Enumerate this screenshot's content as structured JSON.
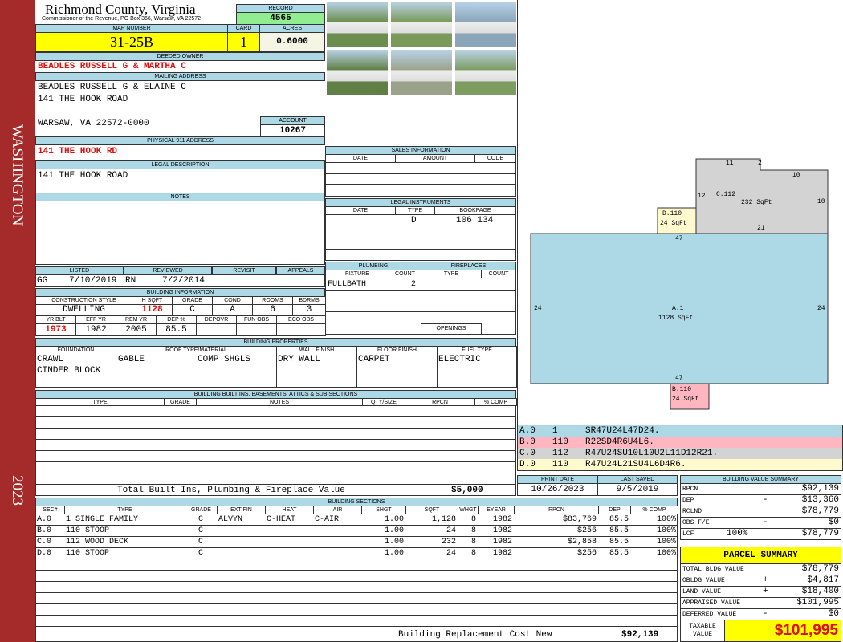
{
  "sidebar": {
    "district": "WASHINGTON",
    "year": "2023"
  },
  "header": {
    "county": "Richmond County, Virginia",
    "subtitle": "Commissioner of the Revenue, PO Box 366, Warsaw, VA 22572",
    "record_label": "RECORD",
    "record": "4565"
  },
  "map": {
    "map_label": "MAP NUMBER",
    "map_number": "31-25B",
    "card_label": "CARD",
    "card": "1",
    "acres_label": "ACRES",
    "acres": "0.6000"
  },
  "owner": {
    "label": "DEEDED OWNER",
    "name": "BEADLES RUSSELL G & MARTHA C"
  },
  "mailing": {
    "label": "MAILING ADDRESS",
    "line1": "BEADLES RUSSELL G & ELAINE C",
    "line2": "141 THE HOOK ROAD",
    "line3": "WARSAW, VA 22572-0000",
    "account_label": "ACCOUNT",
    "account": "10267"
  },
  "physical": {
    "label": "PHYSICAL 911 ADDRESS",
    "address": "141 THE HOOK RD"
  },
  "legal": {
    "label": "LEGAL DESCRIPTION",
    "text": "141 THE HOOK ROAD"
  },
  "notes": {
    "label": "NOTES"
  },
  "review": {
    "listed_label": "LISTED",
    "listed_by": "GG",
    "listed_date": "7/10/2019",
    "reviewed_label": "REVIEWED",
    "reviewed_by": "RN",
    "reviewed_date": "7/2/2014",
    "revisit_label": "REVISIT",
    "appeals_label": "APPEALS"
  },
  "building_info": {
    "label": "BUILDING INFORMATION",
    "h1": [
      "CONSTRUCTION STYLE",
      "H SQFT",
      "GRADE",
      "COND",
      "ROOMS",
      "BDRMS"
    ],
    "v1": [
      "DWELLING",
      "1128",
      "C",
      "A",
      "6",
      "3"
    ],
    "h2": [
      "YR BLT",
      "EFF YR",
      "REM YR",
      "DEP %",
      "DEPOVR",
      "FUN OBS",
      "ECO OBS"
    ],
    "v2": [
      "1973",
      "1982",
      "2005",
      "85.5",
      "",
      "",
      ""
    ]
  },
  "properties": {
    "label": "BUILDING PROPERTIES",
    "headers": [
      "FOUNDATION",
      "ROOF TYPE/MATERIAL",
      "WALL FINISH",
      "FLOOR FINISH",
      "FUEL TYPE"
    ],
    "foundation": [
      "CRAWL",
      "CINDER BLOCK"
    ],
    "roof_type": "GABLE",
    "roof_material": "COMP SHGLS",
    "wall": "DRY WALL",
    "floor": "CARPET",
    "fuel": "ELECTRIC"
  },
  "builtins": {
    "label": "BUILDING BUILT INS, BASEMENTS, ATTICS & SUB SECTIONS",
    "headers": [
      "TYPE",
      "GRADE",
      "NOTES",
      "QTY/SIZE",
      "RPCN",
      "% COMP"
    ],
    "total_label": "Total Built Ins, Plumbing & Fireplace Value",
    "total": "$5,000"
  },
  "sales": {
    "label": "SALES INFORMATION",
    "headers": [
      "DATE",
      "AMOUNT",
      "CODE"
    ]
  },
  "instruments": {
    "label": "LEGAL INSTRUMENTS",
    "headers": [
      "DATE",
      "TYPE",
      "BOOKPAGE"
    ],
    "rows": [
      {
        "date": "",
        "type": "D",
        "bookpage": "106 134"
      }
    ]
  },
  "plumbing": {
    "label": "PLUMBING",
    "headers": [
      "FIXTURE",
      "COUNT"
    ],
    "rows": [
      {
        "fixture": "FULLBATH",
        "count": "2"
      }
    ]
  },
  "fireplaces": {
    "label": "FIREPLACES",
    "headers": [
      "TYPE",
      "COUNT"
    ],
    "openings_label": "OPENINGS"
  },
  "sections": {
    "label": "BUILDING SECTIONS",
    "headers": [
      "SEC#",
      "TYPE",
      "GRADE",
      "EXT FIN",
      "HEAT",
      "AIR",
      "SHGT",
      "SQFT",
      "WHGT",
      "EYEAR",
      "RPCN",
      "DEP",
      "% COMP"
    ],
    "rows": [
      [
        "A.0",
        "1 SINGLE FAMILY",
        "C",
        "ALVYN",
        "C-HEAT",
        "C-AIR",
        "1.00",
        "1,128",
        "8",
        "1982",
        "$83,769",
        "85.5",
        "100%"
      ],
      [
        "B.0",
        "110 STOOP",
        "C",
        "",
        "",
        "",
        "1.00",
        "24",
        "8",
        "1982",
        "$256",
        "85.5",
        "100%"
      ],
      [
        "C.0",
        "112 WOOD DECK",
        "C",
        "",
        "",
        "",
        "1.00",
        "232",
        "8",
        "1982",
        "$2,858",
        "85.5",
        "100%"
      ],
      [
        "D.0",
        "110 STOOP",
        "C",
        "",
        "",
        "",
        "1.00",
        "24",
        "8",
        "1982",
        "$256",
        "85.5",
        "100%"
      ]
    ],
    "total_label": "Building Replacement Cost New",
    "total": "$92,139"
  },
  "sketch": {
    "sections": [
      {
        "label": "A.1",
        "area": "1128 SqFt",
        "color": "#add8e6"
      },
      {
        "label": "B.110",
        "area": "24 SqFt",
        "color": "#ffb6c1"
      },
      {
        "label": "C.112",
        "area": "232 SqFt",
        "color": "#d3d3d3"
      },
      {
        "label": "D.110",
        "area": "24 SqFt",
        "color": "#fffacd"
      }
    ],
    "dims": {
      "a_top": "47",
      "a_bottom": "47",
      "a_left": "24",
      "a_right": "24",
      "c_top": "11",
      "c_notch": "2",
      "c_right_top": "10",
      "c_left": "12",
      "c_right": "10",
      "c_bottom": "21"
    },
    "codes": [
      {
        "sec": "A.0",
        "code": "1",
        "path": "SR47U24L47D24.",
        "color": "#add8e6"
      },
      {
        "sec": "B.0",
        "code": "110",
        "path": "R22SD4R6U4L6.",
        "color": "#ffb6c1"
      },
      {
        "sec": "C.0",
        "code": "112",
        "path": "R47U24SU10L10U2L11D12R21.",
        "color": "#d3d3d3"
      },
      {
        "sec": "D.0",
        "code": "110",
        "path": "R47U24L21SU4L6D4R6.",
        "color": "#fffacd"
      }
    ]
  },
  "dates": {
    "print_label": "PRINT DATE",
    "print": "10/26/2023",
    "saved_label": "LAST SAVED",
    "saved": "9/5/2019"
  },
  "value_summary": {
    "label": "BUILDING VALUE SUMMARY",
    "rows": [
      {
        "name": "RPCN",
        "sign": "",
        "value": "$92,139"
      },
      {
        "name": "DEP",
        "sign": "-",
        "value": "$13,360"
      },
      {
        "name": "RCLND",
        "sign": "",
        "value": "$78,779"
      },
      {
        "name": "OBS F/E",
        "sign": "-",
        "value": "$0"
      },
      {
        "name": "LCF",
        "sign": "100%",
        "value": "$78,779"
      }
    ]
  },
  "parcel": {
    "label": "PARCEL SUMMARY",
    "rows": [
      {
        "name": "TOTAL BLDG VALUE",
        "sign": "",
        "value": "$78,779"
      },
      {
        "name": "OBLDG VALUE",
        "sign": "+",
        "value": "$4,817"
      },
      {
        "name": "LAND VALUE",
        "sign": "+",
        "value": "$18,400"
      },
      {
        "name": "APPRAISED VALUE",
        "sign": "",
        "value": "$101,995"
      },
      {
        "name": "DEFERRED VALUE",
        "sign": "-",
        "value": "$0"
      }
    ],
    "taxable_label": "TAXABLE VALUE",
    "taxable": "$101,995"
  }
}
